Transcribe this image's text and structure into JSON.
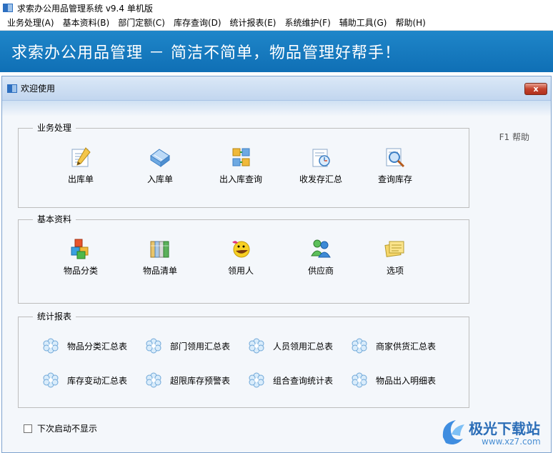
{
  "app": {
    "title": "求索办公用品管理系统 v9.4 单机版"
  },
  "menu": [
    {
      "label": "业务处理(A)"
    },
    {
      "label": "基本资料(B)"
    },
    {
      "label": "部门定额(C)"
    },
    {
      "label": "库存查询(D)"
    },
    {
      "label": "统计报表(E)"
    },
    {
      "label": "系统维护(F)"
    },
    {
      "label": "辅助工具(G)"
    },
    {
      "label": "帮助(H)"
    }
  ],
  "banner": {
    "text": "求索办公用品管理 － 简洁不简单，物品管理好帮手！"
  },
  "welcome": {
    "title": "欢迎使用",
    "close_label": "x",
    "help_label": "F1 帮助",
    "groups": {
      "business": {
        "title": "业务处理",
        "items": [
          {
            "label": "出库单",
            "icon": "outbound-form-icon"
          },
          {
            "label": "入库单",
            "icon": "inbound-form-icon"
          },
          {
            "label": "出入库查询",
            "icon": "inout-query-icon"
          },
          {
            "label": "收发存汇总",
            "icon": "summary-clock-icon"
          },
          {
            "label": "查询库存",
            "icon": "stock-search-icon"
          }
        ]
      },
      "basic": {
        "title": "基本资料",
        "items": [
          {
            "label": "物品分类",
            "icon": "category-blocks-icon"
          },
          {
            "label": "物品清单",
            "icon": "item-list-books-icon"
          },
          {
            "label": "领用人",
            "icon": "recipient-smiley-icon"
          },
          {
            "label": "供应商",
            "icon": "supplier-people-icon"
          },
          {
            "label": "选项",
            "icon": "options-notes-icon"
          }
        ]
      },
      "reports": {
        "title": "统计报表",
        "items": [
          {
            "label": "物品分类汇总表",
            "icon": "snowflake-icon"
          },
          {
            "label": "部门领用汇总表",
            "icon": "snowflake-icon"
          },
          {
            "label": "人员领用汇总表",
            "icon": "snowflake-icon"
          },
          {
            "label": "商家供货汇总表",
            "icon": "snowflake-icon"
          },
          {
            "label": "库存变动汇总表",
            "icon": "snowflake-icon"
          },
          {
            "label": "超限库存预警表",
            "icon": "snowflake-icon"
          },
          {
            "label": "组合查询统计表",
            "icon": "snowflake-icon"
          },
          {
            "label": "物品出入明细表",
            "icon": "snowflake-icon"
          }
        ]
      }
    },
    "dont_show_label": "下次启动不显示"
  },
  "watermark": {
    "name": "极光下载站",
    "url": "www.xz7.com"
  },
  "colors": {
    "banner": "#1479bf",
    "accent": "#2d6fc0"
  }
}
